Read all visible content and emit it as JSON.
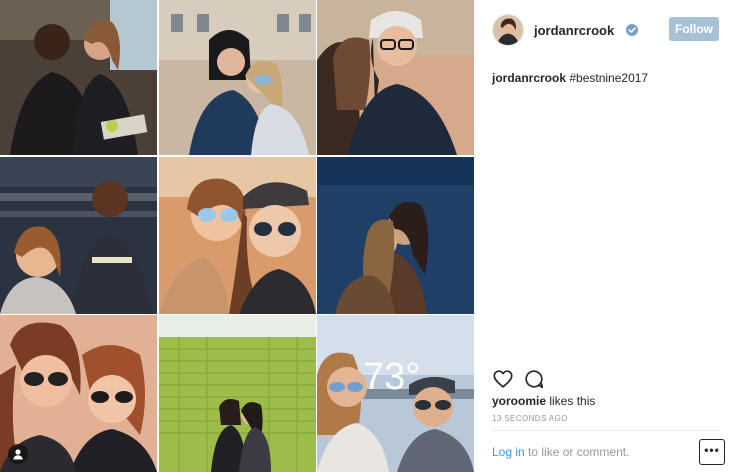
{
  "post": {
    "username": "jordanrcrook",
    "verified": true,
    "follow_label": "Follow",
    "caption_user": "jordanrcrook",
    "caption_text": " #bestnine2017",
    "liked_by": "yoroomie",
    "likes_suffix": " likes this",
    "timestamp": "13 SECONDS AGO",
    "login_link": "Log in",
    "login_suffix": " to like or comment.",
    "more_label": "•••"
  },
  "grid": {
    "photos": [
      {
        "name": "photo-1"
      },
      {
        "name": "photo-2"
      },
      {
        "name": "photo-3"
      },
      {
        "name": "photo-4"
      },
      {
        "name": "photo-5"
      },
      {
        "name": "photo-6"
      },
      {
        "name": "photo-7"
      },
      {
        "name": "photo-8"
      },
      {
        "name": "photo-9"
      }
    ],
    "overlay_text": "73°"
  },
  "icons": {
    "like": "heart-icon",
    "comment": "comment-bubble-icon",
    "verified": "verified-badge-icon",
    "more": "more-options-icon",
    "tagged": "user-tag-icon"
  },
  "colors": {
    "follow_bg": "#a6c0d6",
    "link_blue": "#3897f0",
    "verified_blue": "#7b9fc9",
    "text": "#262626",
    "muted": "#999999"
  }
}
